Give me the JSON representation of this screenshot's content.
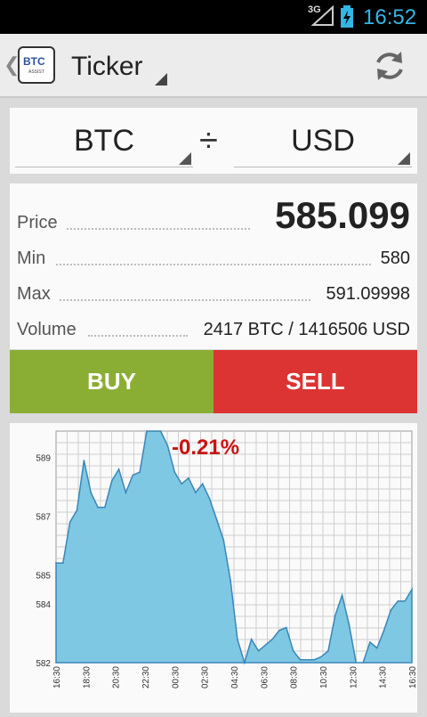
{
  "status_bar": {
    "network": "3G",
    "time": "16:52"
  },
  "action_bar": {
    "logo_text": "BTC",
    "logo_sub": "ASSIST",
    "title": "Ticker"
  },
  "pair": {
    "base": "BTC",
    "separator": "÷",
    "quote": "USD"
  },
  "ticker": {
    "price_label": "Price",
    "price_value": "585.099",
    "min_label": "Min",
    "min_value": "580",
    "max_label": "Max",
    "max_value": "591.09998",
    "volume_label": "Volume",
    "volume_value": "2417 BTC / 1416506 USD"
  },
  "actions": {
    "buy_label": "BUY",
    "sell_label": "SELL"
  },
  "colors": {
    "buy": "#8aae34",
    "sell": "#dc3333",
    "accent": "#33b5e5",
    "chart_fill": "#7ec8e3",
    "change_text": "#cc1111"
  },
  "chart_data": {
    "type": "area",
    "change_label": "-0.21%",
    "yticks": [
      "582",
      "584",
      "585",
      "587",
      "589"
    ],
    "ytick_values": [
      582,
      584,
      585,
      587,
      589
    ],
    "ylim": [
      582,
      589.9
    ],
    "xticks": [
      "16:30",
      "18:30",
      "20:30",
      "22:30",
      "00:30",
      "02:30",
      "04:30",
      "06:30",
      "08:30",
      "10:30",
      "12:30",
      "14:30",
      "16:30"
    ],
    "values": [
      585.4,
      585.4,
      586.8,
      587.2,
      588.9,
      587.8,
      587.3,
      587.3,
      588.2,
      588.6,
      587.8,
      588.4,
      588.5,
      589.9,
      589.9,
      589.9,
      589.4,
      588.5,
      588.1,
      588.3,
      587.8,
      588.1,
      587.6,
      586.9,
      586.2,
      584.8,
      582.8,
      582.0,
      582.8,
      582.4,
      582.6,
      582.8,
      583.1,
      583.2,
      582.4,
      582.1,
      582.1,
      582.1,
      582.2,
      582.4,
      583.6,
      584.3,
      583.3,
      582.0,
      582.0,
      582.7,
      582.5,
      583.1,
      583.8,
      584.1,
      584.1,
      584.5
    ]
  }
}
